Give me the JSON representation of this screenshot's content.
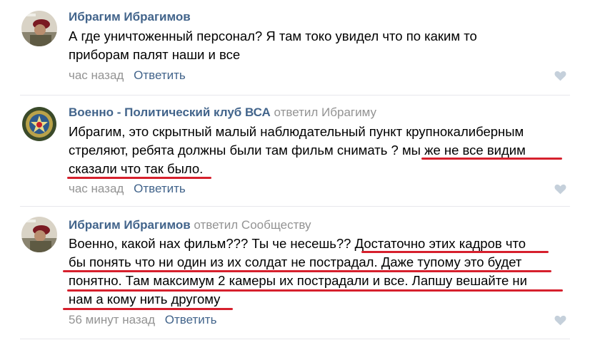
{
  "comments": [
    {
      "author": "Ибрагим Ибрагимов",
      "reply_to": "",
      "lines": [
        "А где уничтоженный персонал? Я там токо увидел что по каким то",
        "приборам палят наши и все"
      ],
      "time": "час назад",
      "reply_label": "Ответить"
    },
    {
      "author": "Военно - Политический клуб ВСА",
      "reply_to": "ответил Ибрагиму",
      "lines": [
        "Ибрагим, это скрытный малый наблюдательный пункт крупнокалиберным",
        "стреляют, ребята должны были там фильм снимать ? мы же не все видим",
        "сказали что так было."
      ],
      "time": "час назад",
      "reply_label": "Ответить"
    },
    {
      "author": "Ибрагим Ибрагимов",
      "reply_to": "ответил Сообществу",
      "lines": [
        "Военно, какой нах фильм??? Ты че несешь?? Достаточно этих кадров что",
        "бы понять что ни один из их солдат не пострадал. Даже тупому это будет",
        "понятно. Там максимум 2 камеры их пострадали и все. Лапшу вешайте ни",
        "нам а кому нить другому"
      ],
      "time": "56 минут назад",
      "reply_label": "Ответить"
    }
  ],
  "colors": {
    "link": "#42648b",
    "muted": "#939393",
    "underline": "#d6202d",
    "divider": "#e7e8ec",
    "like": "#c5d0db"
  },
  "icons": {
    "like": "heart-icon"
  }
}
